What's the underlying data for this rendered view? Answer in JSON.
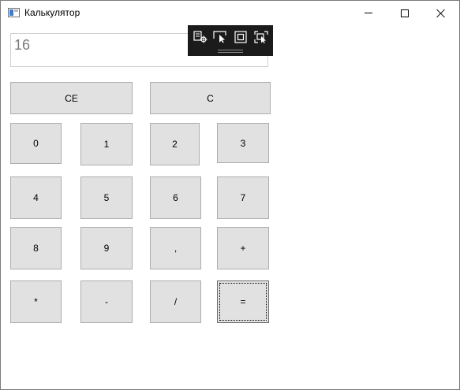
{
  "window": {
    "title": "Калькулятор"
  },
  "display": {
    "value": "16"
  },
  "keys": {
    "ce": "CE",
    "c": "C",
    "d0": "0",
    "d1": "1",
    "d2": "2",
    "d3": "3",
    "d4": "4",
    "d5": "5",
    "d6": "6",
    "d7": "7",
    "d8": "8",
    "d9": "9",
    "comma": ",",
    "plus": "+",
    "multiply": "*",
    "minus": "-",
    "divide": "/",
    "equals": "="
  },
  "icons": {
    "app": "calculator-app-icon",
    "minimize": "minimize-icon",
    "maximize": "maximize-icon",
    "close": "close-icon",
    "devtools": [
      "live-visual-tree-icon",
      "select-element-icon",
      "display-layout-adorners-icon",
      "track-focus-icon"
    ]
  }
}
